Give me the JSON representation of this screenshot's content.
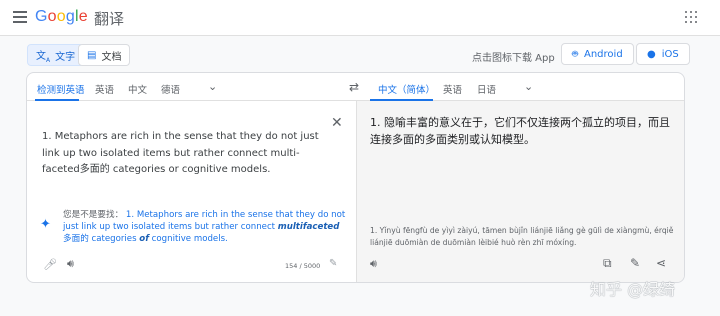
{
  "brand": {
    "logo_letters": [
      "G",
      "o",
      "o",
      "g",
      "l",
      "e"
    ],
    "logo_colors": [
      "#4285f4",
      "#ea4335",
      "#fbbc05",
      "#4285f4",
      "#34a853",
      "#ea4335"
    ],
    "product": "翻译"
  },
  "modes": {
    "text_label": "文字",
    "doc_label": "文档"
  },
  "promo": {
    "download_text": "点击图标下载 App",
    "android_label": "Android",
    "ios_label": "iOS"
  },
  "source_langs": [
    "检测到英语",
    "英语",
    "中文",
    "德语"
  ],
  "target_langs": [
    "中文（简体）",
    "英语",
    "日语"
  ],
  "source": {
    "text": "1. Metaphors are rich in the sense that they do not just link up two isolated items but rather connect multi-faceted多面的 categories or cognitive models.",
    "suggest_prefix": "您是不是要找：",
    "suggest_part1": "1. Metaphors are rich in the sense that they do not just link up two isolated items but rather connect ",
    "suggest_bold1": "multifaceted",
    "suggest_part2": "多面的 categories ",
    "suggest_bold2": "of",
    "suggest_part3": " cognitive models.",
    "char_count": "154 / 5000"
  },
  "target": {
    "text": "1. 隐喻丰富的意义在于，它们不仅连接两个孤立的项目，而且连接多面的多面类别或认知模型。",
    "romanized": "1. Yǐnyù fēngfù de yìyì zàiyú, tāmen bùjǐn liánjiē liǎng gè gūlì de xiàngmù, érqiě liánjiē duōmiàn de duōmiàn lèibié huò rèn zhī móxíng."
  },
  "watermark": "知乎 @绿绮",
  "icons": {
    "menu": "menu-icon",
    "apps": "apps-grid-icon",
    "translate": "translate-icon",
    "document": "document-icon",
    "android": "android-icon",
    "apple": "apple-icon",
    "swap": "swap-icon",
    "close": "close-icon",
    "sparkle": "sparkle-icon",
    "mic": "mic-icon",
    "speaker": "speaker-icon",
    "pencil": "pencil-icon",
    "copy": "copy-icon",
    "share": "share-icon",
    "chevron": "chevron-down-icon"
  },
  "colors": {
    "accent": "#1a73e8",
    "active_bg": "#e8f0fe",
    "target_bg": "#f5f5f5"
  }
}
